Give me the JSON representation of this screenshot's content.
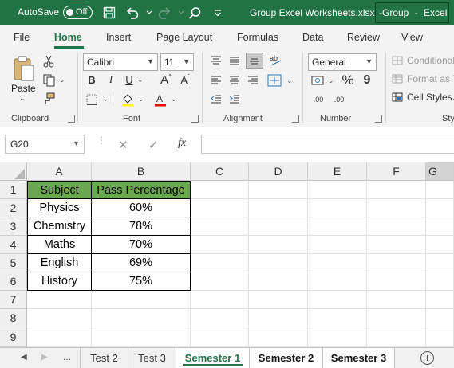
{
  "titlebar": {
    "autosave_label": "AutoSave",
    "autosave_state": "Off",
    "filename": "Group Excel Worksheets.xlsx",
    "separator": "-",
    "mode": "Group",
    "app": "Excel"
  },
  "tabs": [
    "File",
    "Home",
    "Insert",
    "Page Layout",
    "Formulas",
    "Data",
    "Review",
    "View"
  ],
  "active_tab": "Home",
  "ribbon": {
    "clipboard": {
      "paste_label": "Paste",
      "group_label": "Clipboard"
    },
    "font": {
      "name": "Calibri",
      "size": "11",
      "group_label": "Font",
      "bold": "B",
      "italic": "I",
      "underline": "U",
      "grow": "A",
      "shrink": "A",
      "highlight_color": "#ffff00",
      "font_color": "#ff0000"
    },
    "alignment": {
      "group_label": "Alignment"
    },
    "number": {
      "format": "General",
      "percent": "%",
      "comma": "9",
      "group_label": "Number",
      "inc_decimal": ".00",
      "dec_decimal": ".00"
    },
    "styles": {
      "conditional": "Conditional",
      "format_as": "Format as T",
      "cell_styles": "Cell Styles",
      "group_label": "Sty"
    }
  },
  "formula_bar": {
    "name_box": "G20",
    "cancel": "✕",
    "enter": "✓",
    "fx": "fx",
    "value": ""
  },
  "grid": {
    "columns": [
      "A",
      "B",
      "C",
      "D",
      "E",
      "F",
      "G"
    ],
    "rows": [
      "1",
      "2",
      "3",
      "4",
      "5",
      "6",
      "7",
      "8",
      "9"
    ],
    "header_color": "#6aa84f",
    "table": {
      "headers": [
        "Subject",
        "Pass Percentage"
      ],
      "rows": [
        [
          "Physics",
          "60%"
        ],
        [
          "Chemistry",
          "78%"
        ],
        [
          "Maths",
          "70%"
        ],
        [
          "English",
          "69%"
        ],
        [
          "History",
          "75%"
        ]
      ]
    }
  },
  "sheet_tabs": {
    "more": "...",
    "items": [
      "Test 2",
      "Test 3",
      "Semester 1",
      "Semester 2",
      "Semester 3"
    ],
    "active": "Semester 1",
    "add": "+"
  },
  "accent_color": "#217346"
}
